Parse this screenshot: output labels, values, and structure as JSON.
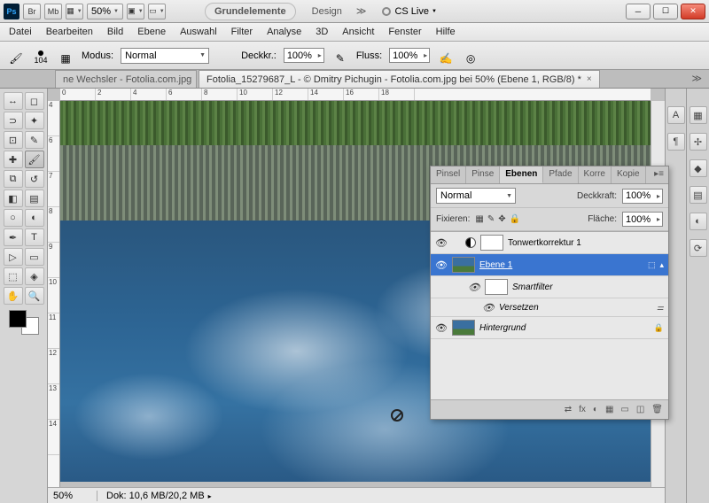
{
  "titlebar": {
    "ps": "Ps",
    "br": "Br",
    "mb": "Mb",
    "zoom": "50%",
    "workspace_active": "Grundelemente",
    "workspace_next": "Design",
    "cs_live": "CS Live"
  },
  "menu": [
    "Datei",
    "Bearbeiten",
    "Bild",
    "Ebene",
    "Auswahl",
    "Filter",
    "Analyse",
    "3D",
    "Ansicht",
    "Fenster",
    "Hilfe"
  ],
  "options": {
    "brush_size": "104",
    "modus_label": "Modus:",
    "modus_value": "Normal",
    "deckkraft_label": "Deckkr.:",
    "deckkraft_value": "100%",
    "fluss_label": "Fluss:",
    "fluss_value": "100%"
  },
  "tabs": {
    "inactive": "ne Wechsler - Fotolia.com.jpg",
    "active": "Fotolia_15279687_L - © Dmitry Pichugin - Fotolia.com.jpg bei 50% (Ebene 1, RGB/8) *"
  },
  "ruler_h": [
    "0",
    "2",
    "4",
    "6",
    "8",
    "10",
    "12",
    "14",
    "16",
    "18"
  ],
  "ruler_v": [
    "4",
    "6",
    "7",
    "8",
    "9",
    "10",
    "11",
    "12",
    "13",
    "14"
  ],
  "status": {
    "zoom": "50%",
    "dok": "Dok: 10,6 MB/20,2 MB"
  },
  "panel": {
    "tabs": [
      "Pinsel",
      "Pinse",
      "Ebenen",
      "Pfade",
      "Korre",
      "Kopie"
    ],
    "active_tab": "Ebenen",
    "blend_mode": "Normal",
    "deckkraft_label": "Deckkraft:",
    "deckkraft_value": "100%",
    "fixieren_label": "Fixieren:",
    "flaeche_label": "Fläche:",
    "flaeche_value": "100%",
    "layers": {
      "l0": "Tonwertkorrektur 1",
      "l1": "Ebene 1",
      "l1_sf": "Smartfilter",
      "l1_eff": "Versetzen",
      "l2": "Hintergrund"
    },
    "footer_icons": [
      "⇄",
      "fx",
      "◐",
      "▦",
      "▭",
      "◫",
      "🗑"
    ]
  }
}
